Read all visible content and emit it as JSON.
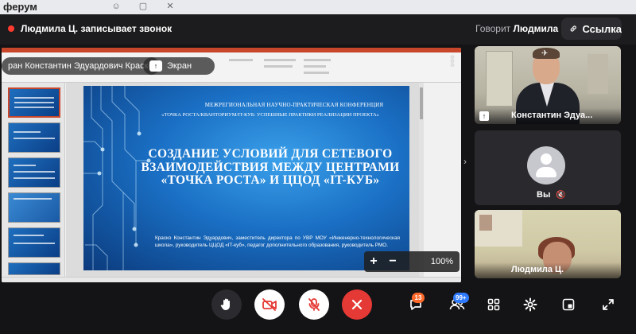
{
  "background_app": {
    "title": "ферум"
  },
  "call": {
    "recording_text": "Людмила Ц. записывает звонок",
    "speaking_label": "Говорит",
    "speaking_name": "Людмила Ц.",
    "link_button": "Ссылка"
  },
  "share": {
    "presenter_name": "ран Константин Эдуардович Краско",
    "screen_label": "Экран",
    "zoom_in": "+",
    "zoom_out": "−",
    "zoom_level": "100%"
  },
  "slide": {
    "conference_line1": "МЕЖРЕГИОНАЛЬНАЯ НАУЧНО-ПРАКТИЧЕСКАЯ КОНФЕРЕНЦИЯ",
    "conference_line2": "«ТОЧКА РОСТА/КВАНТОРИУМ/IT-КУБ: УСПЕШНЫЕ ПРАКТИКИ РЕАЛИЗАЦИИ ПРОЕКТА»",
    "title": "СОЗДАНИЕ УСЛОВИЙ ДЛЯ СЕТЕВОГО ВЗАИМОДЕЙСТВИЯ МЕЖДУ ЦЕНТРАМИ «ТОЧКА РОСТА» И ЦЦОД «IT-КУБ»",
    "description": "Краско Константин Эдуардович, заместитель директора по УВР МОУ «Инженерно-технологическая школа», руководитель ЦЦОД «IT-куб», педагог дополнительного образования, руководитель РМО."
  },
  "participants": [
    {
      "name": "Константин Эдуа...",
      "badge": "↑"
    },
    {
      "name": "Вы",
      "mic": "muted"
    },
    {
      "name": "Людмила Ц."
    }
  ],
  "controls": {
    "chat_count": "13",
    "participants_count": "99+"
  }
}
